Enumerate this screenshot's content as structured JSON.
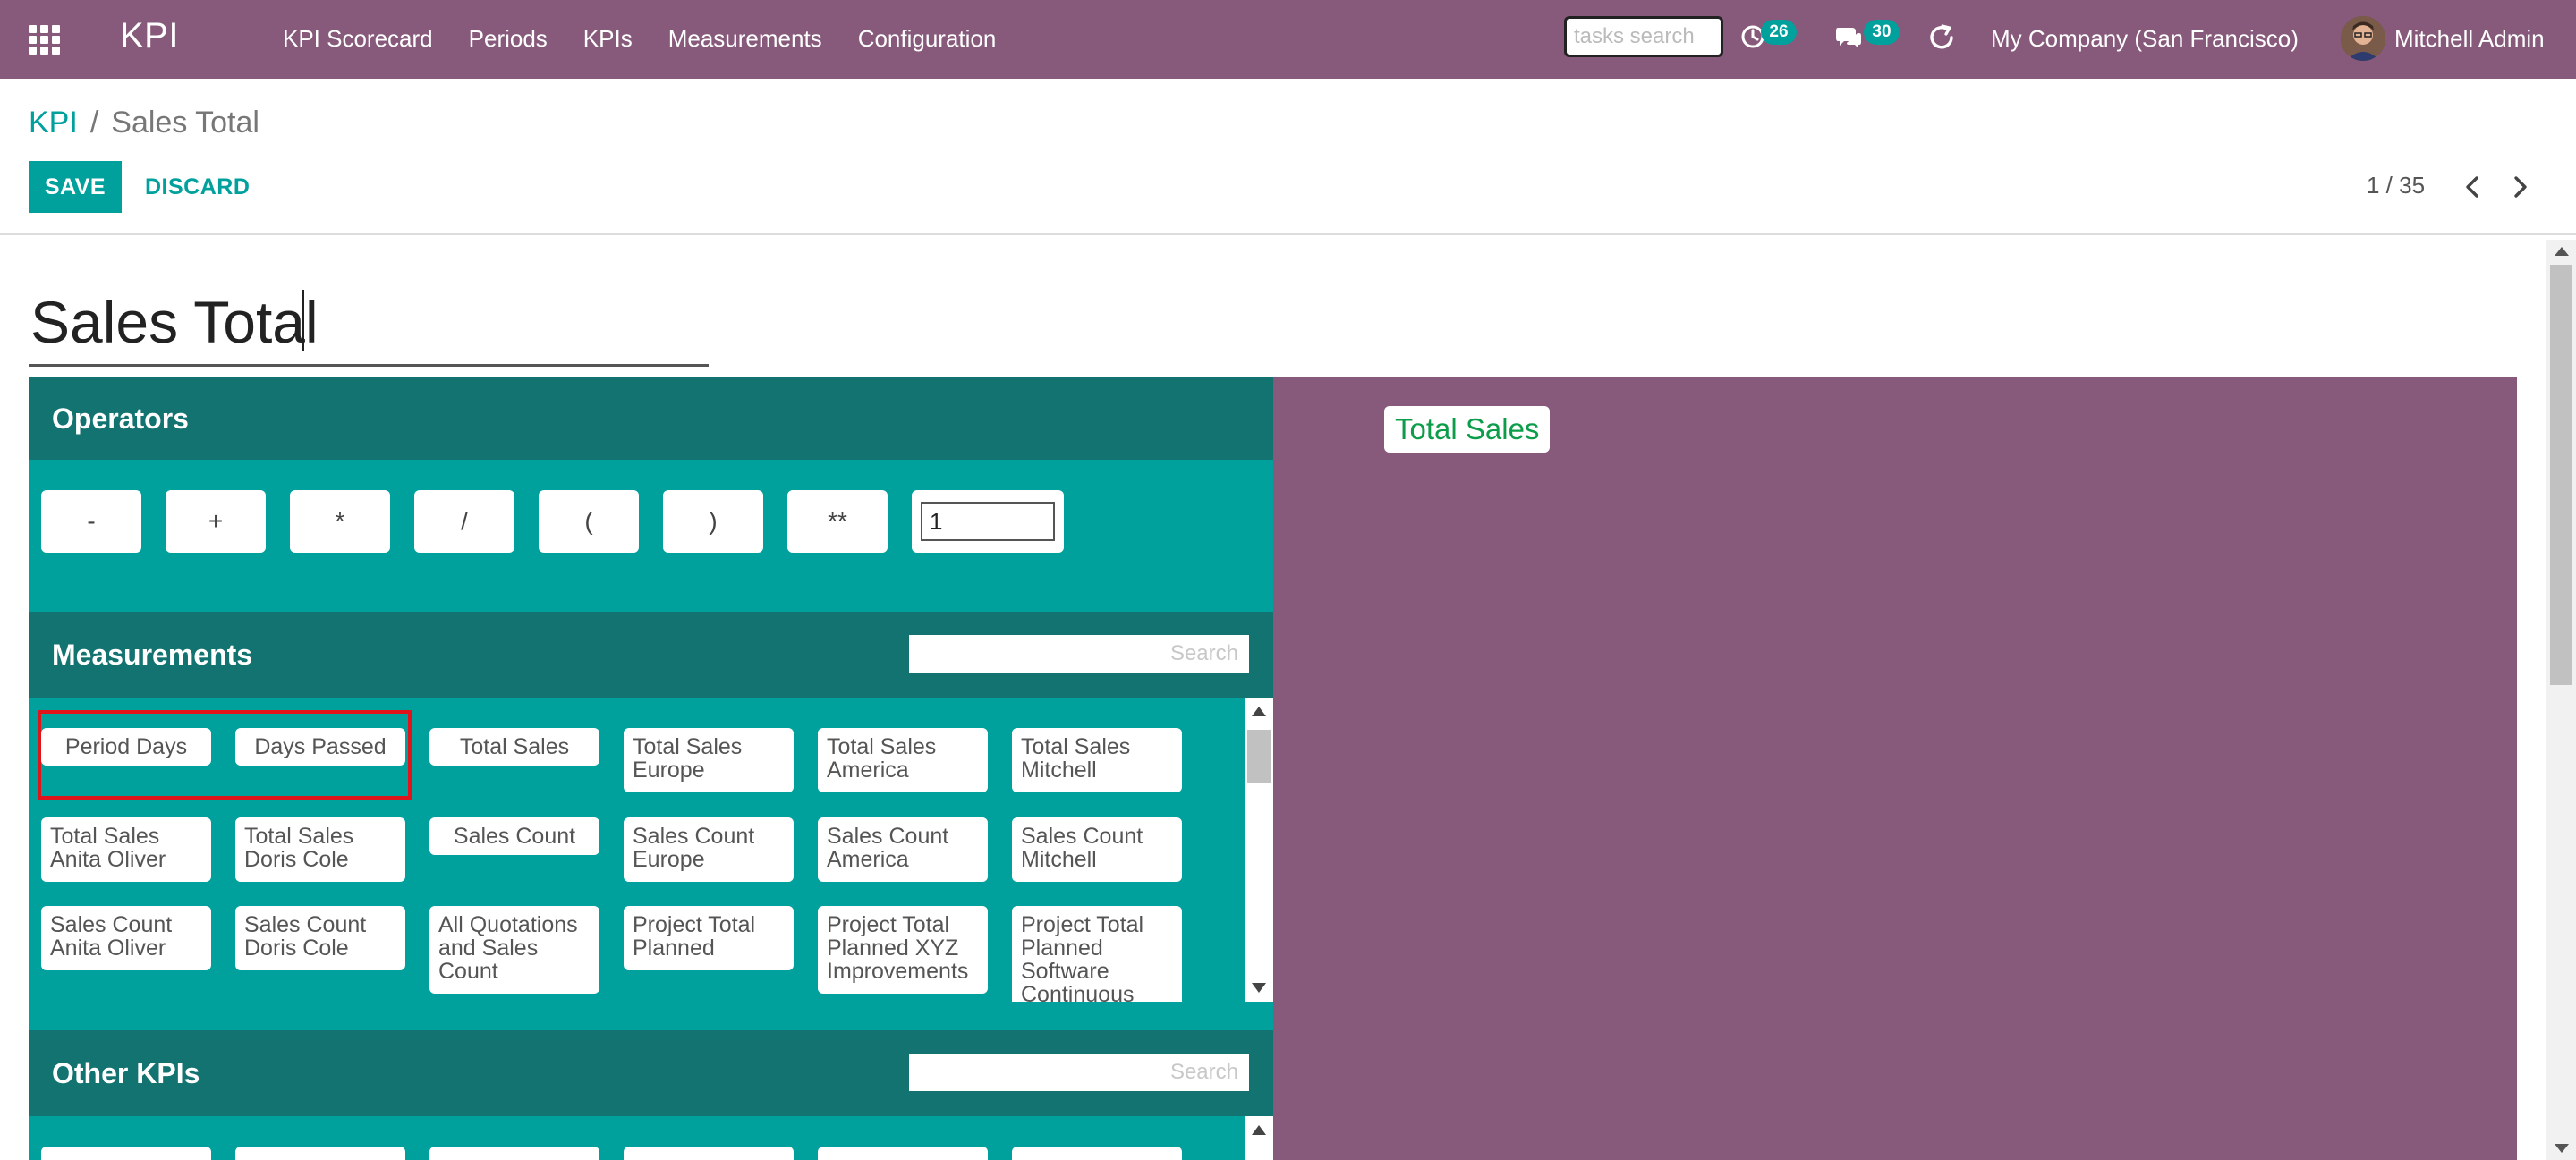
{
  "navbar": {
    "brand": "KPI",
    "menu": [
      "KPI Scorecard",
      "Periods",
      "KPIs",
      "Measurements",
      "Configuration"
    ],
    "tasks_search_placeholder": "tasks search",
    "activities_count": "26",
    "messages_count": "30",
    "company": "My Company (San Francisco)",
    "user": "Mitchell Admin"
  },
  "breadcrumb": {
    "parent": "KPI",
    "separator": "/",
    "current": "Sales Total"
  },
  "actions": {
    "save_label": "SAVE",
    "discard_label": "DISCARD"
  },
  "pager": {
    "text": "1 / 35"
  },
  "form": {
    "name_value": "Sales Total"
  },
  "operators": {
    "title": "Operators",
    "buttons": [
      "-",
      "+",
      "*",
      "/",
      "(",
      ")",
      "**"
    ],
    "constant_value": "1"
  },
  "measurements": {
    "title": "Measurements",
    "search_placeholder": "Search",
    "items": [
      "Period Days",
      "Days Passed",
      "Total Sales",
      "Total Sales Europe",
      "Total Sales America",
      "Total Sales Mitchell",
      "Total Sales Anita Oliver",
      "Total Sales Doris Cole",
      "Sales Count",
      "Sales Count Europe",
      "Sales Count America",
      "Sales Count Mitchell",
      "Sales Count Anita Oliver",
      "Sales Count Doris Cole",
      "All Quotations and Sales Count",
      "Project Total Planned",
      "Project Total Planned XYZ Improvements",
      "Project Total Planned Software Continuous"
    ]
  },
  "other_kpis": {
    "title": "Other KPIs",
    "search_placeholder": "Search"
  },
  "formula": {
    "chips": [
      "Total Sales"
    ]
  },
  "colors": {
    "primary": "#875a7b",
    "accent": "#00a09d",
    "section_header": "#127370",
    "formula_text": "#0d9d4a",
    "highlight": "#e0141b"
  }
}
